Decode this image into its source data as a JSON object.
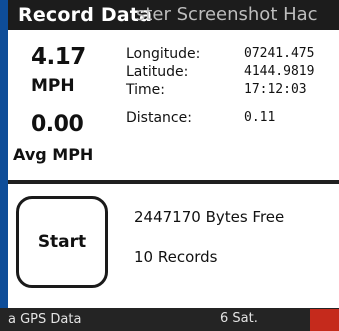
{
  "app": {
    "title": "Record Data",
    "title_overlay": "ster Screenshot Hac"
  },
  "speed": {
    "value": "4.17",
    "unit": "MPH"
  },
  "average": {
    "value": "0.00",
    "unit": "Avg MPH"
  },
  "info": [
    {
      "label": "Longitude:",
      "value": "07241.475"
    },
    {
      "label": "Latitude:",
      "value": "4144.9819"
    },
    {
      "label": "Time:",
      "value": "17:12:03"
    },
    {
      "label": "Distance:",
      "value": "0.11"
    }
  ],
  "controls": {
    "start_label": "Start"
  },
  "storage": {
    "bytes_free": "2447170 Bytes Free",
    "records": "10 Records"
  },
  "status": {
    "left": "a GPS Data",
    "right": "6 Sat."
  },
  "colors": {
    "bezel": "#0e4d99",
    "titlebar": "#1c1c1c",
    "screen": "#ffffff",
    "badge": "#c52a1c"
  }
}
